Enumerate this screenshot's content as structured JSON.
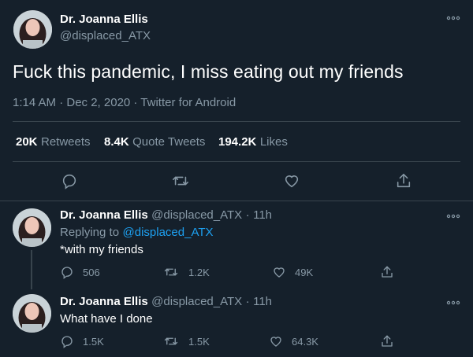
{
  "main_tweet": {
    "author_name": "Dr. Joanna Ellis",
    "author_handle": "@displaced_ATX",
    "text": "Fuck this pandemic, I miss eating out my friends",
    "meta": "1:14 AM · Dec 2, 2020 · Twitter for Android",
    "stats": {
      "retweets_count": "20K",
      "retweets_label": "Retweets",
      "quotes_count": "8.4K",
      "quotes_label": "Quote Tweets",
      "likes_count": "194.2K",
      "likes_label": "Likes"
    },
    "actions": [
      "reply-icon",
      "retweet-icon",
      "like-icon",
      "share-icon"
    ]
  },
  "replies": [
    {
      "author_name": "Dr. Joanna Ellis",
      "author_handle": "@displaced_ATX",
      "dot": "·",
      "time": "11h",
      "replying_prefix": "Replying to",
      "replying_handle": "@displaced_ATX",
      "text": "*with my friends",
      "reply_count": "506",
      "retweet_count": "1.2K",
      "like_count": "49K"
    },
    {
      "author_name": "Dr. Joanna Ellis",
      "author_handle": "@displaced_ATX",
      "dot": "·",
      "time": "11h",
      "text": "What have I done",
      "reply_count": "1.5K",
      "retweet_count": "1.5K",
      "like_count": "64.3K"
    }
  ],
  "colors": {
    "background": "#15202b",
    "muted": "#8899a6",
    "link": "#1da1f2",
    "divider": "#38444d"
  }
}
